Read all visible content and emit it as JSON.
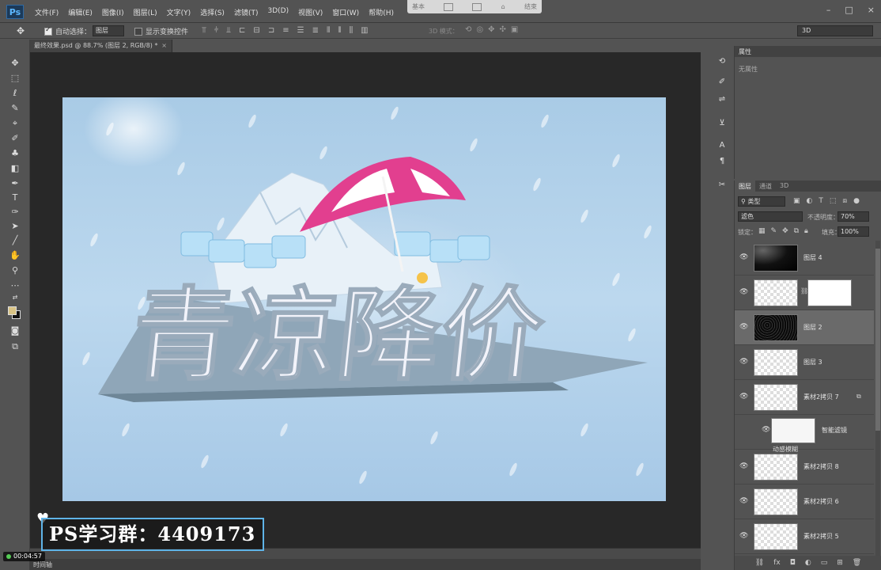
{
  "app": {
    "logo": "Ps"
  },
  "menu": [
    "文件(F)",
    "编辑(E)",
    "图像(I)",
    "图层(L)",
    "文字(Y)",
    "选择(S)",
    "滤镜(T)",
    "3D(D)",
    "视图(V)",
    "窗口(W)",
    "帮助(H)"
  ],
  "workspace_buttons": {
    "left": "基本",
    "right": "结束"
  },
  "window_controls": [
    "–",
    "□",
    "×"
  ],
  "options": {
    "auto_select_label": "自动选择：",
    "auto_select_checked": true,
    "layer_select": "图层",
    "show_transform_label": "显示变换控件",
    "show_transform_checked": false,
    "mode_3d_label": "3D 模式：",
    "workspace": "3D"
  },
  "document": {
    "tab_title": "最终效果.psd @ 88.7% (图层 2, RGB/8) *",
    "close": "×"
  },
  "tools": [
    {
      "name": "move-tool",
      "glyph": "✥"
    },
    {
      "name": "marquee-tool",
      "glyph": "⬚"
    },
    {
      "name": "lasso-tool",
      "glyph": "ℓ"
    },
    {
      "name": "quick-select-tool",
      "glyph": "✎"
    },
    {
      "name": "eyedropper-tool",
      "glyph": "⌖"
    },
    {
      "name": "brush-tool",
      "glyph": "✐"
    },
    {
      "name": "clone-stamp-tool",
      "glyph": "♣"
    },
    {
      "name": "eraser-tool",
      "glyph": "◧"
    },
    {
      "name": "pen-tool",
      "glyph": "✒"
    },
    {
      "name": "type-tool",
      "glyph": "T"
    },
    {
      "name": "path-select-tool",
      "glyph": "➤"
    },
    {
      "name": "path-tool",
      "glyph": "⟋"
    },
    {
      "name": "line-tool",
      "glyph": "╱"
    },
    {
      "name": "hand-tool",
      "glyph": "✋"
    },
    {
      "name": "zoom-tool",
      "glyph": "⚲"
    },
    {
      "name": "more-tools",
      "glyph": "…"
    }
  ],
  "colors": {
    "foreground": "#d9c486",
    "background": "#111111",
    "watermark_border": "#5fb4e8"
  },
  "artwork": {
    "headline": "青凉降价"
  },
  "watermark": {
    "text": "PS学习群：4409173",
    "heart": "♥"
  },
  "timer": {
    "text": "00:04:57"
  },
  "timeline": {
    "label": "时间轴"
  },
  "properties": {
    "tab": "属性",
    "content": "无属性"
  },
  "layers": {
    "tabs": [
      "图层",
      "通道",
      "3D"
    ],
    "filter": "类型",
    "blend_mode": "滤色",
    "opacity_label": "不透明度：",
    "opacity": "70%",
    "lock_label": "锁定：",
    "fill_label": "填充：",
    "fill": "100%",
    "items": [
      {
        "name": "图层 4",
        "thumb": "dark",
        "selected": false
      },
      {
        "name": "",
        "thumb": "pattern",
        "mask": true,
        "selected": false
      },
      {
        "name": "图层 2",
        "thumb": "noise",
        "selected": true
      },
      {
        "name": "图层 3",
        "thumb": "pattern",
        "selected": false
      },
      {
        "name": "素材2拷贝 7",
        "thumb": "pattern",
        "selected": false
      }
    ],
    "smart_filter": {
      "name": "智能滤镜",
      "effect": "动感模糊"
    },
    "items_after": [
      {
        "name": "素材2拷贝 8"
      },
      {
        "name": "素材2拷贝 6"
      },
      {
        "name": "素材2拷贝 5"
      }
    ]
  }
}
